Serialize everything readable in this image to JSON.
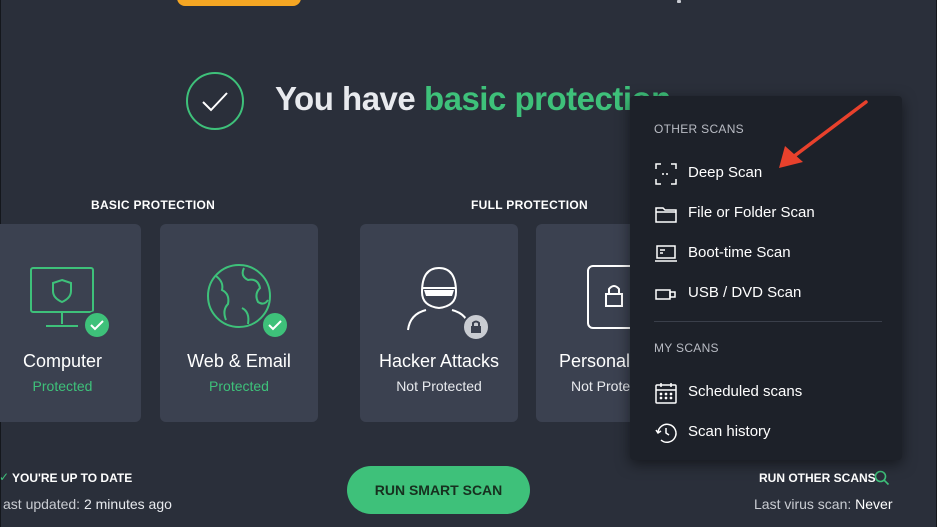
{
  "headline": {
    "prefix": "You have",
    "accent": "basic protection"
  },
  "sections": {
    "basic": "BASIC PROTECTION",
    "full": "FULL PROTECTION"
  },
  "cards": [
    {
      "name": "Computer",
      "status": "Protected"
    },
    {
      "name": "Web & Email",
      "status": "Protected"
    },
    {
      "name": "Hacker Attacks",
      "status": "Not Protected"
    },
    {
      "name": "Personal",
      "status": "Not Prote"
    }
  ],
  "footer": {
    "uptodate": "YOU'RE UP TO DATE",
    "last_updated_label": "ast updated:",
    "last_updated_value": "2 minutes ago",
    "run_smart_scan": "RUN SMART SCAN",
    "run_other_scans": "RUN OTHER SCANS",
    "last_virus_scan_label": "Last virus scan:",
    "last_virus_scan_value": "Never"
  },
  "menu": {
    "other_header": "OTHER SCANS",
    "other_items": [
      "Deep Scan",
      "File or Folder Scan",
      "Boot-time Scan",
      "USB / DVD Scan"
    ],
    "my_header": "MY SCANS",
    "my_items": [
      "Scheduled scans",
      "Scan history"
    ]
  },
  "colors": {
    "accent_green": "#3ec17a",
    "background": "#2a2f3a",
    "card": "#3b4150",
    "menu": "#1d2129",
    "arrow": "#e8412c",
    "top_pill": "#f5a623"
  }
}
